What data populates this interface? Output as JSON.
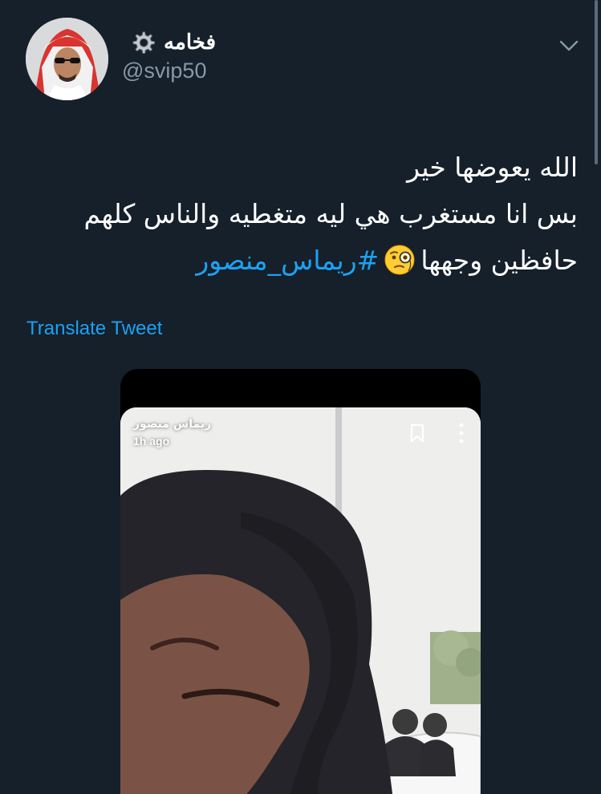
{
  "tweet": {
    "author": {
      "display_name": "فخامه",
      "badge_icon": "gear-icon",
      "handle": "@svip50",
      "avatar_icon": "profile-avatar"
    },
    "menu_icon": "chevron-down-icon",
    "text_lines": [
      "الله يعوضها خير",
      "بس انا مستغرب هي ليه متغطيه والناس كلهم"
    ],
    "last_line": {
      "text": "حافظين وجهها",
      "emoji": "face-with-monocle-emoji",
      "hashtag": "#ريماس_منصور"
    },
    "translate_label": "Translate Tweet",
    "media": {
      "story_user": "ريماس منصور",
      "story_time": "1h ago",
      "bookmark_icon": "bookmark-icon",
      "more_icon": "more-vertical-icon"
    }
  },
  "colors": {
    "background": "#15202b",
    "accent": "#1da1f2",
    "secondary_text": "#8899a6",
    "primary_text": "#ffffff"
  }
}
